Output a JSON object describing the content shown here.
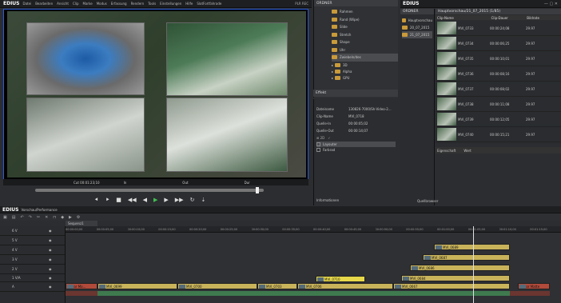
{
  "app": {
    "logo": "EDIUS",
    "menu": [
      "Datei",
      "Bearbeiten",
      "Ansicht",
      "Clip",
      "Marke",
      "Modus",
      "Erfassung",
      "Rendern",
      "Tools",
      "Einstellungen",
      "Hilfe",
      "SlotFortfahrade"
    ],
    "mode_label": "PLR REC"
  },
  "player": {
    "cut_in": "Cut 00:01:23;10",
    "in_label": "In",
    "out_label": "Out",
    "dur_label": "Dur"
  },
  "bin": {
    "header": "ORDNER",
    "items": [
      "Rahmen",
      "Rand (Wipe)",
      "Slide",
      "Stretch",
      "Shape",
      "Uhr",
      "Zwiebeln/des"
    ],
    "tree": [
      "3D",
      "Alpha",
      "GPU"
    ],
    "effect_label": "Effekt"
  },
  "info": {
    "rows": [
      {
        "k": "Dateiname",
        "v": "130826-7000/Sh-Video-2..."
      },
      {
        "k": "Clip-Name",
        "v": "MVI_0718"
      },
      {
        "k": "Quelle-In",
        "v": "00:00:05;02"
      },
      {
        "k": "Quelle-Out",
        "v": "00:00:14;07"
      }
    ],
    "layers": [
      {
        "name": "Layouter",
        "checked": true
      },
      {
        "name": "Farbrad",
        "checked": true
      }
    ],
    "tab": "Informationen"
  },
  "source": {
    "logo": "EDIUS",
    "header": "ORDNER",
    "path": "Hauptvorschau/21_07_2015 (1/85)",
    "columns": [
      "Clip-Name",
      "Clip-Dauer",
      "Bildrate"
    ],
    "folders": [
      "Hauptvorschau",
      "20_07_2015",
      "21_07_2015"
    ],
    "clips": [
      {
        "name": "MVI_0733",
        "dur": "00:00:24;08",
        "fps": "29.97"
      },
      {
        "name": "MVI_0734",
        "dur": "00:00:06;25",
        "fps": "29.97"
      },
      {
        "name": "MVI_0735",
        "dur": "00:00:10;01",
        "fps": "29.97"
      },
      {
        "name": "MVI_0736",
        "dur": "00:00:08;16",
        "fps": "29.97"
      },
      {
        "name": "MVI_0737",
        "dur": "00:00:08;02",
        "fps": "29.97"
      },
      {
        "name": "MVI_0738",
        "dur": "00:00:11;08",
        "fps": "29.97"
      },
      {
        "name": "MVI_0739",
        "dur": "00:00:12;05",
        "fps": "29.97"
      },
      {
        "name": "MVI_0740",
        "dur": "00:00:15;21",
        "fps": "29.97"
      }
    ],
    "tabs": [
      "Eigenschaft",
      "Wert"
    ],
    "bottom_tab": "Quellbrowser"
  },
  "timeline": {
    "logo": "EDIUS",
    "project": "Vorschau/Performance",
    "sequence": "Sequenz1",
    "ruler": [
      "00:00:00;00",
      "00:00:05;00",
      "00:00:10;00",
      "00:00:15;00",
      "00:00:20;00",
      "00:00:25;00",
      "00:00:30;00",
      "00:00:35;00",
      "00:00:40;00",
      "00:00:45;00",
      "00:00:50;00",
      "00:00:55;00",
      "00:01:00;00",
      "00:01:05;00",
      "00:01:10;00",
      "00:01:15;00"
    ],
    "tracks": [
      "6 V",
      "5 V",
      "4 V",
      "3 V",
      "2 V",
      "1 V/A",
      "A"
    ],
    "clips": {
      "mvi0689": "MVI_0689",
      "mvi0687": "MVI_0687",
      "mvi0686": "MVI_0686",
      "mvi0684": "MVI_0684",
      "mvi0710": "MVI_0710",
      "color_matte": "Color Ma...",
      "mvi0699": "MVI_0699",
      "mvi0700": "MVI_0700",
      "mvi0703": "MVI_0703",
      "mvi0706": "MVI_0706",
      "mvi0667": "MVI_0667",
      "color_matte2": "Color Matte"
    }
  },
  "colors": {
    "accent": "#2a5bd7",
    "clip_yellow": "#c8b35a",
    "clip_bright": "#e6d84a",
    "clip_red": "#b04a3a",
    "playhead": "#e0e0e0"
  }
}
